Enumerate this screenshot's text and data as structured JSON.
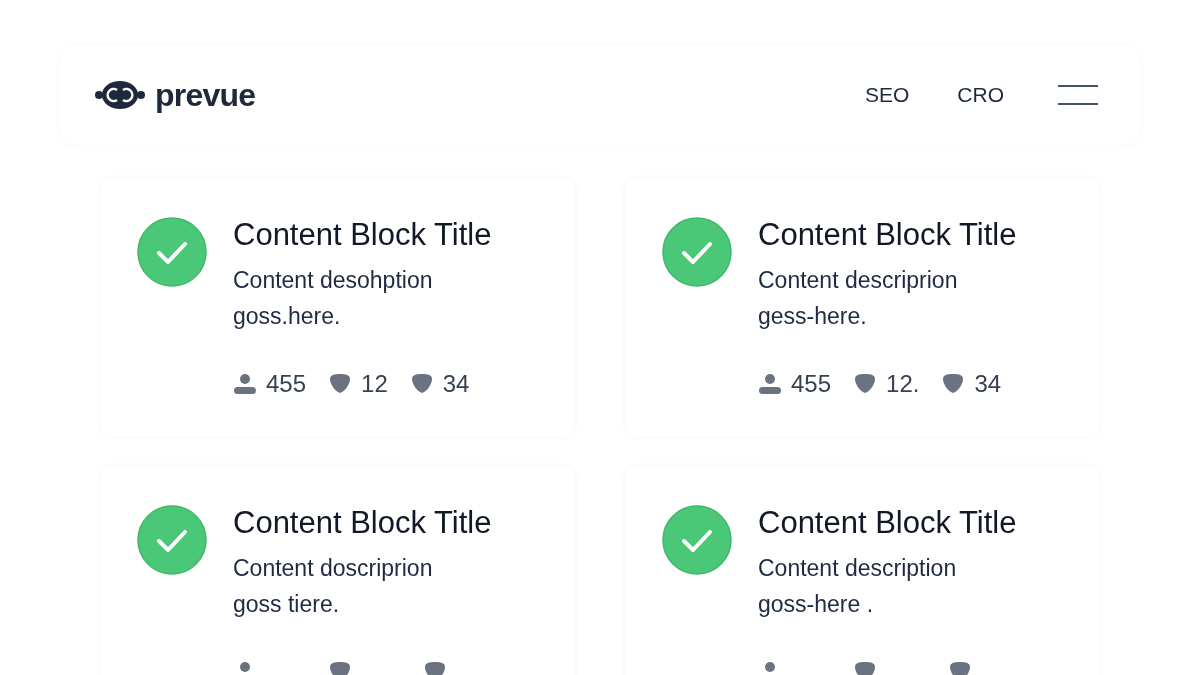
{
  "header": {
    "brand": "prevue",
    "nav": [
      "SEO",
      "CRO"
    ]
  },
  "cards": [
    {
      "done": true,
      "title": "Content Block Title",
      "description": "Content desohption goss.here.",
      "stats": [
        {
          "kind": "people",
          "value": "455"
        },
        {
          "kind": "comments",
          "value": "12"
        },
        {
          "kind": "likes",
          "value": "34"
        }
      ]
    },
    {
      "done": true,
      "title": "Content Block Title",
      "description": "Content descriprion gess-here.",
      "stats": [
        {
          "kind": "people",
          "value": "455"
        },
        {
          "kind": "comments",
          "value": "12."
        },
        {
          "kind": "likes",
          "value": "34"
        }
      ]
    },
    {
      "done": true,
      "title": "Content Block Title",
      "description": "Content doscriprion goss tiere.",
      "stats": [
        {
          "kind": "people"
        },
        {
          "kind": "comments"
        },
        {
          "kind": "likes"
        }
      ]
    },
    {
      "done": true,
      "title": "Content Block Title",
      "description": "Content description goss-here .",
      "stats": [
        {
          "kind": "people"
        },
        {
          "kind": "comments"
        },
        {
          "kind": "likes"
        }
      ]
    }
  ]
}
